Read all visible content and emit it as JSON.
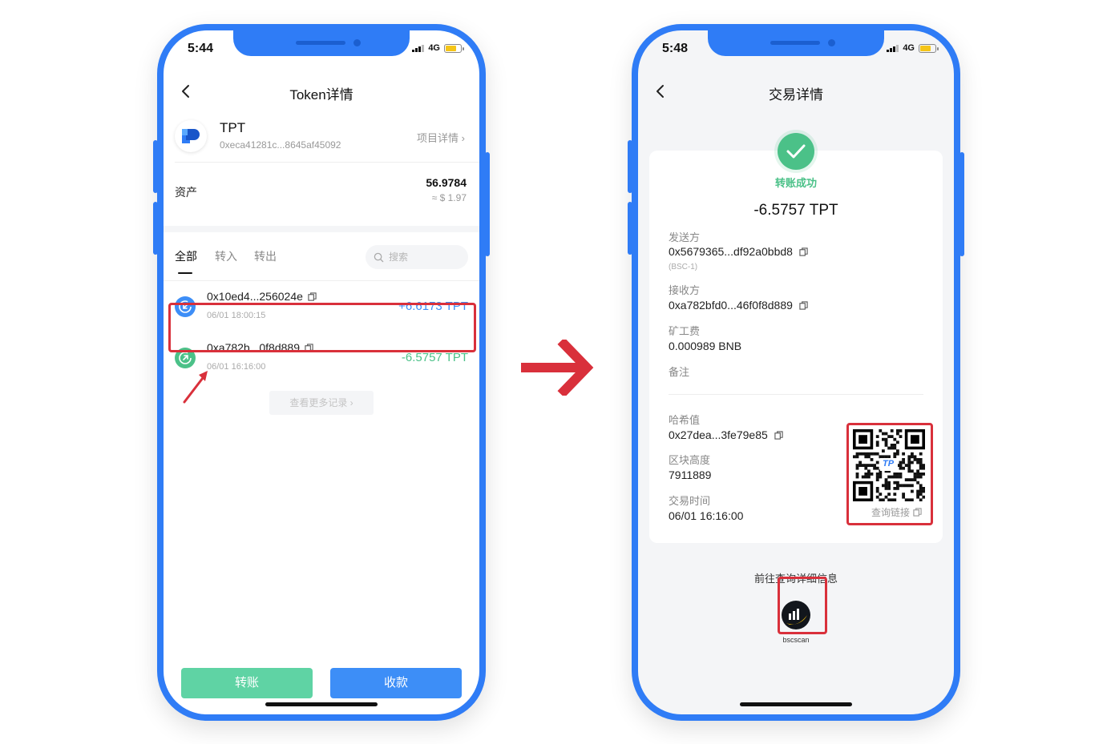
{
  "left_phone": {
    "status": {
      "time": "5:44",
      "network": "4G"
    },
    "nav": {
      "title": "Token详情"
    },
    "token": {
      "name": "TPT",
      "address": "0xeca41281c...8645af45092",
      "project_link": "项目详情 ›"
    },
    "asset": {
      "label": "资产",
      "amount": "56.9784",
      "fiat": "≈ $ 1.97"
    },
    "tabs": [
      {
        "label": "全部"
      },
      {
        "label": "转入"
      },
      {
        "label": "转出"
      }
    ],
    "search": {
      "placeholder": "搜索"
    },
    "transactions": [
      {
        "hash": "0x10ed4...256024e",
        "time": "06/01 18:00:15",
        "amount": "+6.6173 TPT",
        "direction": "in"
      },
      {
        "hash": "0xa782b...0f8d889",
        "time": "06/01 16:16:00",
        "amount": "-6.5757 TPT",
        "direction": "out"
      }
    ],
    "more_records": "查看更多记录 ›",
    "buttons": {
      "transfer": "转账",
      "receive": "收款"
    }
  },
  "right_phone": {
    "status": {
      "time": "5:48",
      "network": "4G"
    },
    "nav": {
      "title": "交易详情"
    },
    "status_text": "转账成功",
    "amount": "-6.5757 TPT",
    "fields": {
      "sender_label": "发送方",
      "sender_value": "0x5679365...df92a0bbd8",
      "sender_network": "(BSC-1)",
      "receiver_label": "接收方",
      "receiver_value": "0xa782bfd0...46f0f8d889",
      "fee_label": "矿工费",
      "fee_value": "0.000989 BNB",
      "memo_label": "备注",
      "hash_label": "哈希值",
      "hash_value": "0x27dea...3fe79e85",
      "block_label": "区块高度",
      "block_value": "7911889",
      "time_label": "交易时间",
      "time_value": "06/01 16:16:00"
    },
    "qr": {
      "link_label": "查询链接",
      "badge": "TP"
    },
    "goto_text": "前往查询详细信息",
    "explorer": {
      "label": "bscscan"
    }
  },
  "colors": {
    "frame": "#2f7cf6",
    "incoming": "#3d8ef7",
    "outgoing": "#4bc188",
    "highlight": "#d9303b",
    "transfer_button": "#5fd3a4",
    "receive_button": "#3d8ef7"
  }
}
